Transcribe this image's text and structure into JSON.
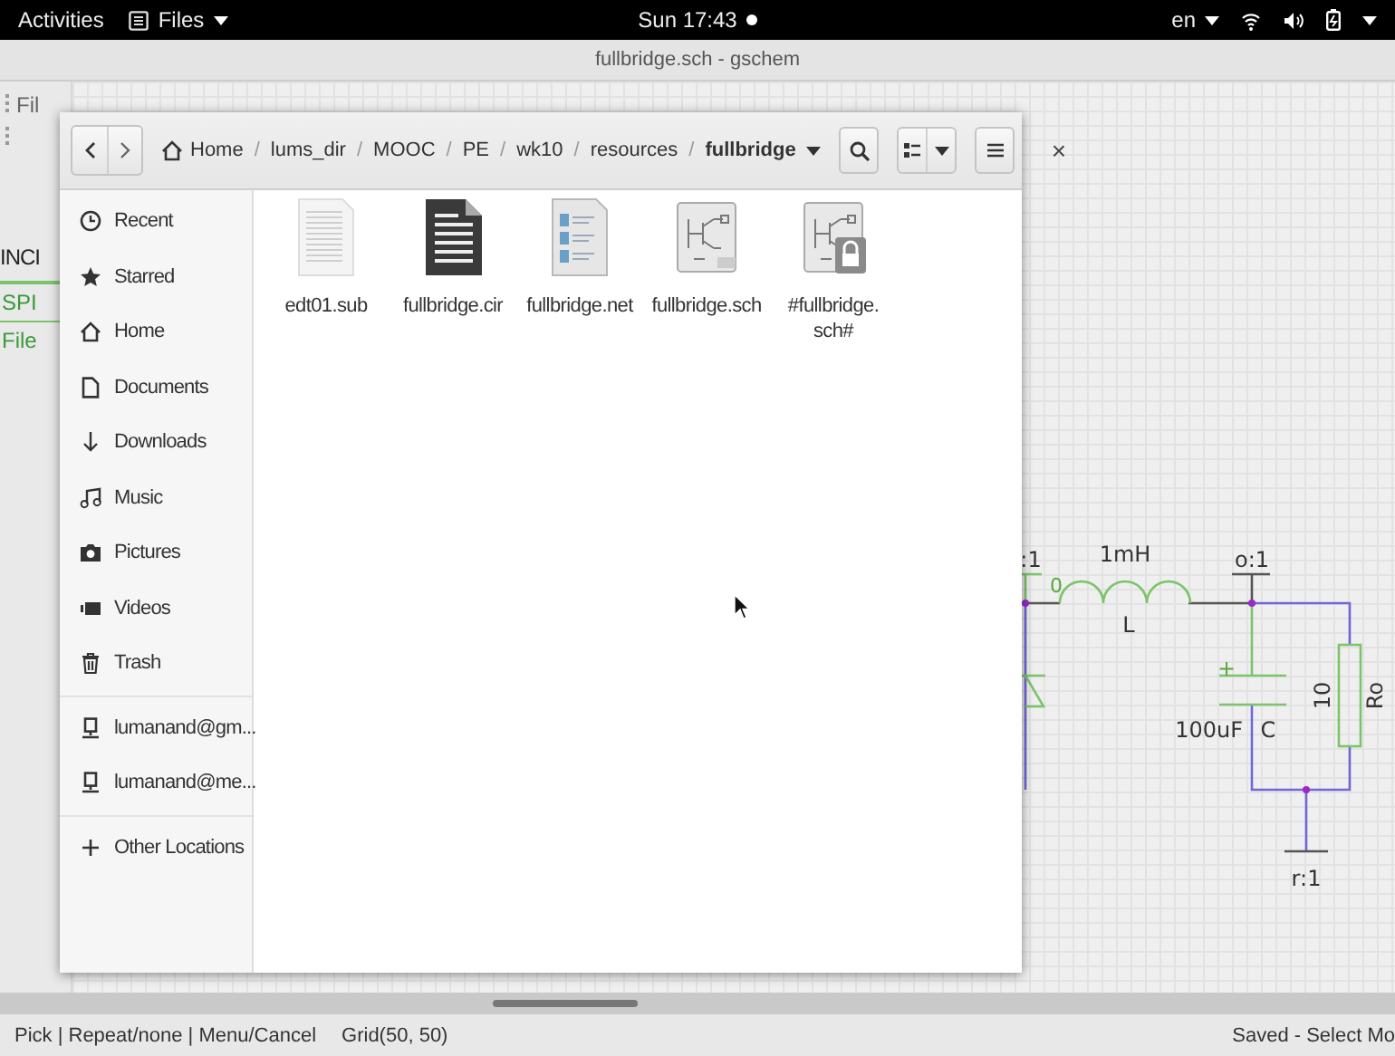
{
  "top_bar": {
    "activities": "Activities",
    "app_menu": "Files",
    "clock": "Sun 17:43",
    "language": "en"
  },
  "gschem": {
    "title": "fullbridge.sch - gschem",
    "menu_fragment": "Fil",
    "side_fragments": [
      {
        "label": "INCI",
        "kind": "heading"
      },
      {
        "label": "SPI",
        "kind": "tab"
      },
      {
        "label": "File",
        "kind": "link"
      }
    ],
    "schematic": {
      "left_pin": ":1",
      "left_net": "0",
      "inductor_value": "1mH",
      "inductor_name": "L",
      "output_pin": "o:1",
      "capacitor_polarity": "+",
      "capacitor_value": "100uF",
      "capacitor_name": "C",
      "resistor_value": "10",
      "resistor_name": "Ro",
      "ground_pin": "r:1"
    },
    "status_bar": {
      "hints": "Pick | Repeat/none | Menu/Cancel",
      "grid": "Grid(50, 50)",
      "state": "Saved - Select Mo"
    }
  },
  "file_dialog": {
    "path": [
      {
        "kind": "home",
        "label": "Home"
      },
      {
        "kind": "separator",
        "label": "/"
      },
      {
        "kind": "folder",
        "label": "lums_dir"
      },
      {
        "kind": "separator",
        "label": "/"
      },
      {
        "kind": "folder",
        "label": "MOOC"
      },
      {
        "kind": "separator",
        "label": "/"
      },
      {
        "kind": "folder",
        "label": "PE"
      },
      {
        "kind": "separator",
        "label": "/"
      },
      {
        "kind": "folder",
        "label": "wk10"
      },
      {
        "kind": "separator",
        "label": "/"
      },
      {
        "kind": "folder",
        "label": "resources"
      },
      {
        "kind": "separator",
        "label": "/"
      },
      {
        "kind": "current",
        "label": "fullbridge"
      }
    ],
    "close": "×",
    "sidebar": {
      "places": [
        {
          "label": "Recent",
          "kind": "recent"
        },
        {
          "label": "Starred",
          "kind": "starred"
        },
        {
          "label": "Home",
          "kind": "home"
        },
        {
          "label": "Documents",
          "kind": "documents"
        },
        {
          "label": "Downloads",
          "kind": "downloads"
        },
        {
          "label": "Music",
          "kind": "music"
        },
        {
          "label": "Pictures",
          "kind": "pictures"
        },
        {
          "label": "Videos",
          "kind": "videos"
        },
        {
          "label": "Trash",
          "kind": "trash"
        }
      ],
      "accounts": [
        {
          "label": "lumanand@gm...",
          "kind": "account"
        },
        {
          "label": "lumanand@me...",
          "kind": "account"
        }
      ],
      "other": [
        {
          "label": "Other Locations",
          "kind": "other"
        }
      ]
    },
    "files": [
      {
        "lines": [
          "edt01.sub"
        ],
        "kind": "subcircuit"
      },
      {
        "lines": [
          "fullbridge.cir"
        ],
        "kind": "netlist"
      },
      {
        "lines": [
          "fullbridge.net"
        ],
        "kind": "net"
      },
      {
        "lines": [
          "fullbridge.sch"
        ],
        "kind": "schematic"
      },
      {
        "lines": [
          "#fullbridge.",
          "sch#"
        ],
        "kind": "backup"
      }
    ]
  }
}
